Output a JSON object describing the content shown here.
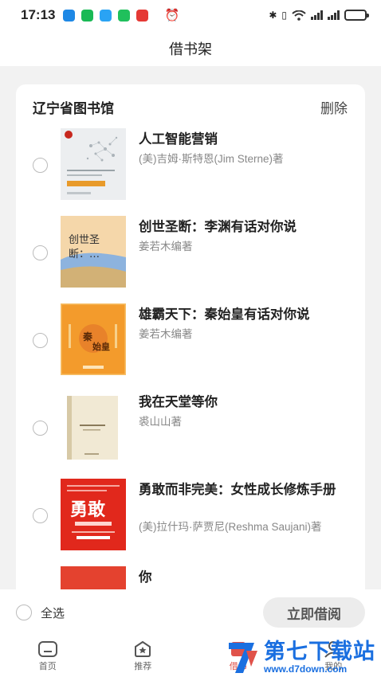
{
  "status_bar": {
    "time": "17:13",
    "icons": [
      "location-app-icon",
      "wechat-icon",
      "message-icon",
      "bag-icon",
      "news-badge-icon",
      "alarm-icon",
      "bluetooth-icon",
      "vibrate-icon",
      "wifi-icon",
      "signal-icon",
      "signal-icon",
      "battery-icon"
    ]
  },
  "header": {
    "title": "借书架"
  },
  "shelf": {
    "library_name": "辽宁省图书馆",
    "delete_label": "删除",
    "books": [
      {
        "title": "人工智能营销",
        "author": "(美)吉姆·斯特恩(Jim Sterne)著",
        "cover_color": "#d9dde0"
      },
      {
        "title": "创世圣断：李渊有话对你说",
        "author": "姜若木编著",
        "cover_text": "创世圣\n断：...",
        "cover_color": "#f3cfa2"
      },
      {
        "title": "雄霸天下：秦始皇有话对你说",
        "author": "姜若木编著",
        "cover_text": "秦始皇",
        "cover_color": "#f29a2e"
      },
      {
        "title": "我在天堂等你",
        "author": "裘山山著",
        "cover_color": "#efe6cf"
      },
      {
        "title": "勇敢而非完美：女性成长修炼手册",
        "author": "(美)拉什玛·萨贾尼(Reshma Saujani)著",
        "cover_text": "勇敢",
        "cover_color": "#e0281d"
      },
      {
        "title": "你",
        "author": "",
        "cover_color": "#e4422f"
      }
    ]
  },
  "footer": {
    "select_all_label": "全选",
    "borrow_label": "立即借阅"
  },
  "tabs": [
    {
      "label": "首页",
      "icon": "home-icon"
    },
    {
      "label": "推荐",
      "icon": "star-box-icon"
    },
    {
      "label": "借书",
      "icon": "book-icon",
      "active": true
    },
    {
      "label": "我的",
      "icon": "user-icon"
    }
  ],
  "watermark": {
    "title": "第七下载站",
    "url": "www.d7down.com"
  }
}
